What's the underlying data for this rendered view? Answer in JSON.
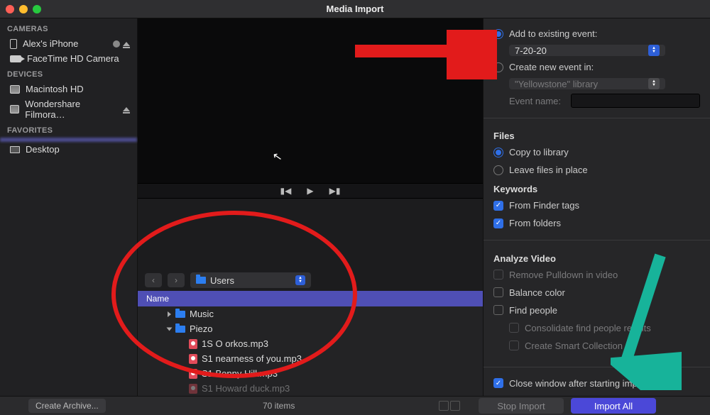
{
  "window": {
    "title": "Media Import"
  },
  "sidebar": {
    "sections": [
      {
        "header": "CAMERAS",
        "items": [
          {
            "label": "Alex's iPhone",
            "icon": "phone",
            "hasStatus": true,
            "hasEject": true
          },
          {
            "label": "FaceTime HD Camera",
            "icon": "cam"
          }
        ]
      },
      {
        "header": "DEVICES",
        "items": [
          {
            "label": "Macintosh HD",
            "icon": "disk"
          },
          {
            "label": "Wondershare Filmora…",
            "icon": "disk",
            "hasEject": true
          }
        ]
      },
      {
        "header": "FAVORITES",
        "items": [
          {
            "label": "",
            "icon": "",
            "selected": true
          },
          {
            "label": "Desktop",
            "icon": "monitor"
          }
        ]
      }
    ]
  },
  "pathbar": {
    "current": "Users"
  },
  "fileBrowser": {
    "columnHeader": "Name",
    "rows": [
      {
        "name": "Music",
        "type": "folder",
        "depth": 1,
        "expanded": false,
        "disclosure": true
      },
      {
        "name": "Piezo",
        "type": "folder",
        "depth": 1,
        "expanded": true,
        "disclosure": true
      },
      {
        "name": "1S O orkos.mp3",
        "type": "audio",
        "depth": 2
      },
      {
        "name": "S1 nearness of you.mp3",
        "type": "audio",
        "depth": 2
      },
      {
        "name": "S1 Benny Hill.mp3",
        "type": "audio",
        "depth": 2
      },
      {
        "name": "S1 Howard duck.mp3",
        "type": "audio",
        "depth": 2
      }
    ]
  },
  "right": {
    "addExisting": {
      "label": "Add to existing event:",
      "value": "7-20-20",
      "selected": true
    },
    "createNew": {
      "label": "Create new event in:",
      "value": "\"Yellowstone\" library",
      "selected": false
    },
    "eventNameLabel": "Event name:",
    "filesHeader": "Files",
    "copy": {
      "label": "Copy to library",
      "selected": true
    },
    "leave": {
      "label": "Leave files in place",
      "selected": false
    },
    "keywordsHeader": "Keywords",
    "finderTags": {
      "label": "From Finder tags",
      "checked": true
    },
    "fromFolders": {
      "label": "From folders",
      "checked": true
    },
    "analyzeHeader": "Analyze Video",
    "removePulldown": {
      "label": "Remove Pulldown in video",
      "checked": false
    },
    "balanceColor": {
      "label": "Balance color",
      "checked": false
    },
    "findPeople": {
      "label": "Find people",
      "checked": false
    },
    "consolidate": {
      "label": "Consolidate find people results"
    },
    "smartCollection": {
      "label": "Create Smart Collection"
    },
    "closeWindow": {
      "label": "Close window after starting import",
      "checked": true
    }
  },
  "bottom": {
    "createArchive": "Create Archive...",
    "itemCount": "70 items",
    "stopImport": "Stop Import",
    "importAll": "Import All"
  }
}
